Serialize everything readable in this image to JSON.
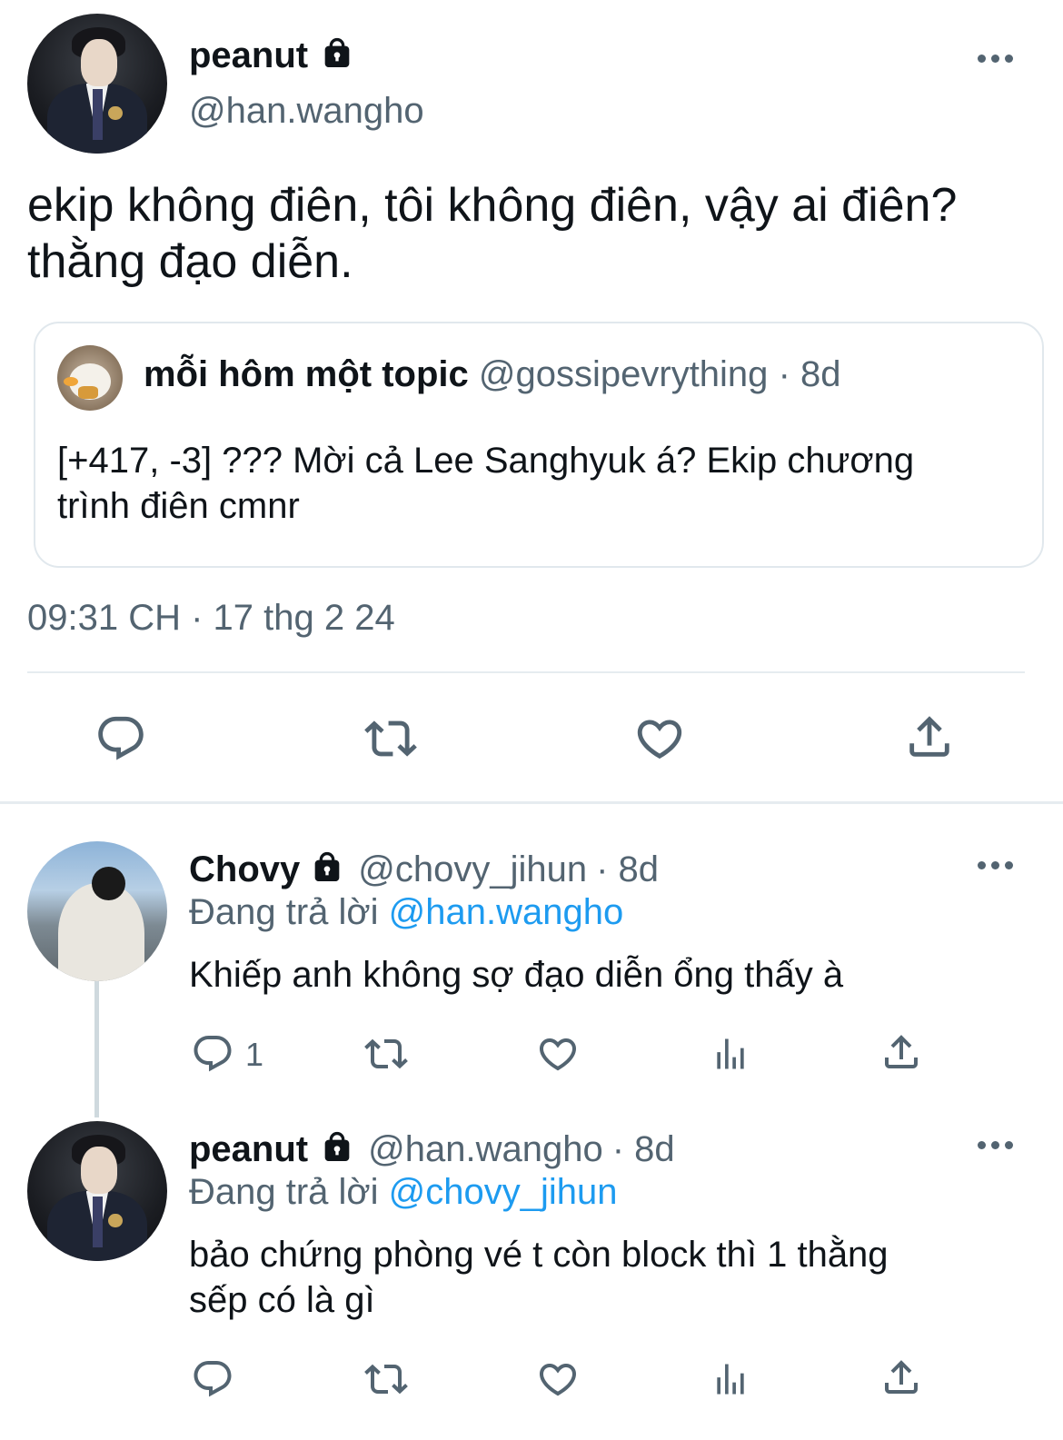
{
  "main_tweet": {
    "author_name": "peanut",
    "author_handle": "@han.wangho",
    "text_line1": "ekip không điên, tôi không điên, vậy ai điên?",
    "text_line2": "thằng đạo diễn.",
    "timestamp": "09:31 CH · 17 thg 2 24",
    "avatar_icon": "profile-photo",
    "quoted": {
      "author_name": "mỗi hôm một topic",
      "author_handle": "@gossipevrything",
      "time": "· 8d",
      "text_line1": "[+417, -3] ??? Mời cả Lee Sanghyuk á? Ekip chương",
      "text_line2": "trình điên cmnr"
    }
  },
  "replies": [
    {
      "author_name": "Chovy",
      "author_handle": "@chovy_jihun",
      "time": "· 8d",
      "replying_prefix": "Đang trả lời",
      "replying_to": "@han.wangho",
      "text_line1": "Khiếp anh không sợ đạo diễn ổng thấy à",
      "text_line2": "",
      "reply_count": "1"
    },
    {
      "author_name": "peanut",
      "author_handle": "@han.wangho",
      "time": "· 8d",
      "replying_prefix": "Đang trả lời",
      "replying_to": "@chovy_jihun",
      "text_line1": "bảo chứng phòng vé t còn block thì 1 thằng",
      "text_line2": "sếp có là gì",
      "reply_count": ""
    }
  ],
  "colors": {
    "text": "#0f1419",
    "muted": "#536471",
    "link": "#1d9bf0",
    "border": "#e1e8ed"
  }
}
